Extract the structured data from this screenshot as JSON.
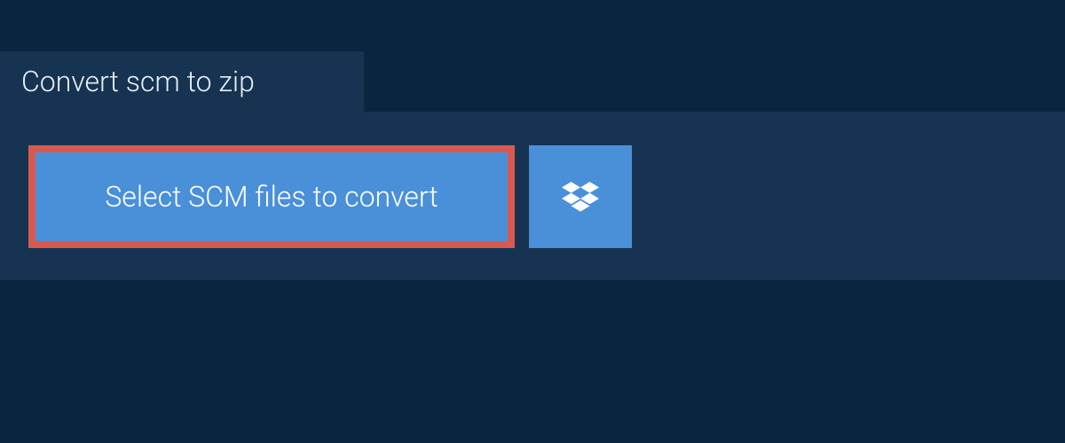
{
  "tab": {
    "title": "Convert scm to zip"
  },
  "actions": {
    "select_label": "Select SCM files to convert"
  },
  "icons": {
    "dropbox": "dropbox-icon"
  },
  "colors": {
    "background": "#0a2540",
    "panel": "#163451",
    "button": "#4a90d9",
    "highlight_border": "#d85a4f"
  }
}
